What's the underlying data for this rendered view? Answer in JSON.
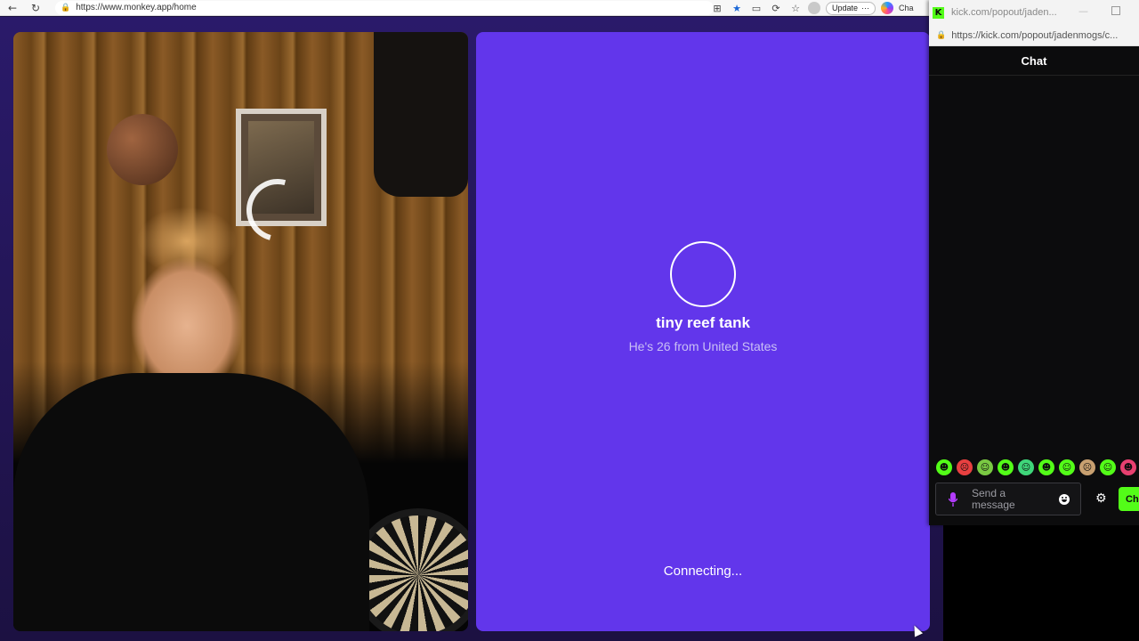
{
  "browser": {
    "url": "https://www.monkey.app/home",
    "update_label": "Update",
    "update_more": "···",
    "copilot_label": "Cha"
  },
  "monkey": {
    "peer": {
      "name": "tiny reef tank",
      "subtitle": "He's 26 from United States",
      "status": "Connecting..."
    },
    "colors": {
      "peer_panel": "#6236eb",
      "page_bg": "#2a1a6a"
    }
  },
  "popout": {
    "title": "kick.com/popout/jaden...",
    "url": "https://kick.com/popout/jadenmogs/c...",
    "chat_header": "Chat",
    "input_placeholder": "Send a message",
    "send_label": "Ch",
    "emotes": [
      {
        "name": "emote-1",
        "color": "#53fc18",
        "glyph": "☻"
      },
      {
        "name": "emote-2",
        "color": "#e84040",
        "glyph": "☹"
      },
      {
        "name": "emote-3",
        "color": "#7ac943",
        "glyph": "☺"
      },
      {
        "name": "emote-4",
        "color": "#53fc18",
        "glyph": "☻"
      },
      {
        "name": "emote-5",
        "color": "#3fd67a",
        "glyph": "☺"
      },
      {
        "name": "emote-6",
        "color": "#53fc18",
        "glyph": "☻"
      },
      {
        "name": "emote-7",
        "color": "#53fc18",
        "glyph": "☺"
      },
      {
        "name": "emote-8",
        "color": "#c8a070",
        "glyph": "☹"
      },
      {
        "name": "emote-9",
        "color": "#53fc18",
        "glyph": "☺"
      },
      {
        "name": "emote-10",
        "color": "#e84070",
        "glyph": "☻"
      }
    ],
    "colors": {
      "accent": "#53fc18",
      "background": "#0c0c0d",
      "mic": "#b43cff"
    }
  }
}
